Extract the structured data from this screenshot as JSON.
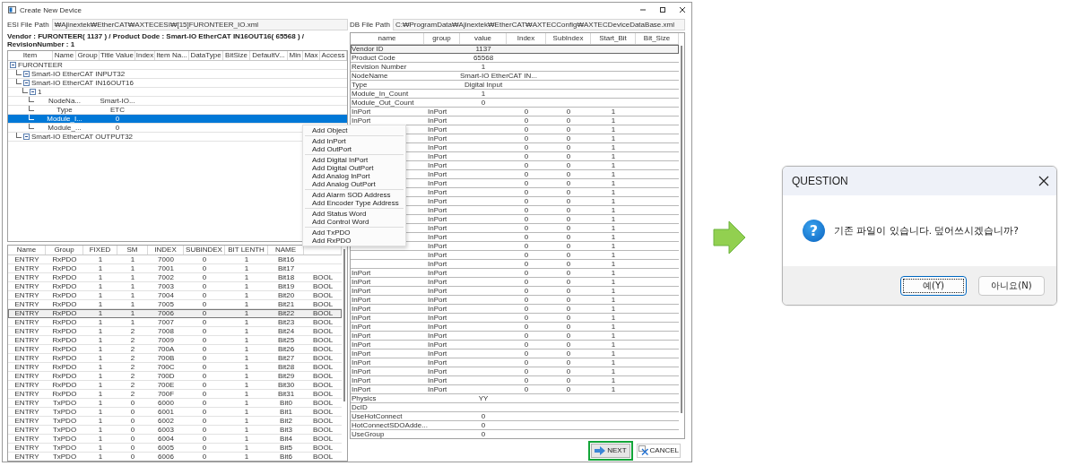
{
  "window": {
    "title": "Create New Device"
  },
  "esi_path": {
    "label": "ESI File Path",
    "value": "₩Ajinextek₩EtherCAT₩AXTECESI₩[15]FURONTEER_IO.xml"
  },
  "vendor_info": "Vendor : FURONTEER( 1137 ) / Product Dode : Smart-IO EtherCAT IN16OUT16( 65568 ) / RevisionNumber : 1",
  "tree_grid": {
    "columns": [
      "Item",
      "Name",
      "Group",
      "Title Value",
      "Index",
      "Item Na...",
      "DataType",
      "BitSize",
      "DefaultV...",
      "Min",
      "Max",
      "Access"
    ],
    "nodes": [
      {
        "item": "FURONTEER",
        "selected": false,
        "children": [
          {
            "item": "Smart-IO EtherCAT INPUT32",
            "selected": false
          },
          {
            "item": "Smart-IO EtherCAT IN16OUT16",
            "selected": false,
            "children": [
              {
                "item": "1",
                "selected": false,
                "children": [
                  {
                    "name": "NodeNa...",
                    "title_value": "Smart-IO...",
                    "selected": false
                  },
                  {
                    "name": "Type",
                    "title_value": "ETC",
                    "selected": false
                  },
                  {
                    "name": "Module_I...",
                    "title_value": "0",
                    "selected": true
                  },
                  {
                    "name": "Module_...",
                    "title_value": "0",
                    "selected": false
                  }
                ]
              }
            ]
          },
          {
            "item": "Smart-IO EtherCAT OUTPUT32",
            "selected": false
          }
        ]
      }
    ]
  },
  "pdo_table": {
    "columns": [
      "Name",
      "Group",
      "FIXED",
      "SM",
      "INDEX",
      "SUBINDEX",
      "BIT LENTH",
      "NAME"
    ],
    "rows": [
      {
        "cells": [
          "ENTRY",
          "RxPDO",
          "1",
          "1",
          "7000",
          "0",
          "1",
          "Bit16"
        ],
        "selected": false
      },
      {
        "cells": [
          "ENTRY",
          "RxPDO",
          "1",
          "1",
          "7001",
          "0",
          "1",
          "Bit17"
        ],
        "selected": false
      },
      {
        "cells": [
          "ENTRY",
          "RxPDO",
          "1",
          "1",
          "7002",
          "0",
          "1",
          "Bit18",
          "BOOL"
        ],
        "selected": false
      },
      {
        "cells": [
          "ENTRY",
          "RxPDO",
          "1",
          "1",
          "7003",
          "0",
          "1",
          "Bit19",
          "BOOL"
        ],
        "selected": false
      },
      {
        "cells": [
          "ENTRY",
          "RxPDO",
          "1",
          "1",
          "7004",
          "0",
          "1",
          "Bit20",
          "BOOL"
        ],
        "selected": false
      },
      {
        "cells": [
          "ENTRY",
          "RxPDO",
          "1",
          "1",
          "7005",
          "0",
          "1",
          "Bit21",
          "BOOL"
        ],
        "selected": false
      },
      {
        "cells": [
          "ENTRY",
          "RxPDO",
          "1",
          "1",
          "7006",
          "0",
          "1",
          "Bit22",
          "BOOL"
        ],
        "selected": true
      },
      {
        "cells": [
          "ENTRY",
          "RxPDO",
          "1",
          "1",
          "7007",
          "0",
          "1",
          "Bit23",
          "BOOL"
        ],
        "selected": false
      },
      {
        "cells": [
          "ENTRY",
          "RxPDO",
          "1",
          "2",
          "7008",
          "0",
          "1",
          "Bit24",
          "BOOL"
        ],
        "selected": false
      },
      {
        "cells": [
          "ENTRY",
          "RxPDO",
          "1",
          "2",
          "7009",
          "0",
          "1",
          "Bit25",
          "BOOL"
        ],
        "selected": false
      },
      {
        "cells": [
          "ENTRY",
          "RxPDO",
          "1",
          "2",
          "700A",
          "0",
          "1",
          "Bit26",
          "BOOL"
        ],
        "selected": false
      },
      {
        "cells": [
          "ENTRY",
          "RxPDO",
          "1",
          "2",
          "700B",
          "0",
          "1",
          "Bit27",
          "BOOL"
        ],
        "selected": false
      },
      {
        "cells": [
          "ENTRY",
          "RxPDO",
          "1",
          "2",
          "700C",
          "0",
          "1",
          "Bit28",
          "BOOL"
        ],
        "selected": false
      },
      {
        "cells": [
          "ENTRY",
          "RxPDO",
          "1",
          "2",
          "700D",
          "0",
          "1",
          "Bit29",
          "BOOL"
        ],
        "selected": false
      },
      {
        "cells": [
          "ENTRY",
          "RxPDO",
          "1",
          "2",
          "700E",
          "0",
          "1",
          "Bit30",
          "BOOL"
        ],
        "selected": false
      },
      {
        "cells": [
          "ENTRY",
          "RxPDO",
          "1",
          "2",
          "700F",
          "0",
          "1",
          "Bit31",
          "BOOL"
        ],
        "selected": false
      },
      {
        "cells": [
          "ENTRY",
          "TxPDO",
          "1",
          "0",
          "6000",
          "0",
          "1",
          "Bit0",
          "BOOL"
        ],
        "selected": false
      },
      {
        "cells": [
          "ENTRY",
          "TxPDO",
          "1",
          "0",
          "6001",
          "0",
          "1",
          "Bit1",
          "BOOL"
        ],
        "selected": false
      },
      {
        "cells": [
          "ENTRY",
          "TxPDO",
          "1",
          "0",
          "6002",
          "0",
          "1",
          "Bit2",
          "BOOL"
        ],
        "selected": false
      },
      {
        "cells": [
          "ENTRY",
          "TxPDO",
          "1",
          "0",
          "6003",
          "0",
          "1",
          "Bit3",
          "BOOL"
        ],
        "selected": false
      },
      {
        "cells": [
          "ENTRY",
          "TxPDO",
          "1",
          "0",
          "6004",
          "0",
          "1",
          "Bit4",
          "BOOL"
        ],
        "selected": false
      },
      {
        "cells": [
          "ENTRY",
          "TxPDO",
          "1",
          "0",
          "6005",
          "0",
          "1",
          "Bit5",
          "BOOL"
        ],
        "selected": false
      },
      {
        "cells": [
          "ENTRY",
          "TxPDO",
          "1",
          "0",
          "6006",
          "0",
          "1",
          "Bit6",
          "BOOL"
        ],
        "selected": false
      }
    ]
  },
  "db_path": {
    "label": "DB File Path",
    "value": "C:₩ProgramData₩Ajinextek₩EtherCAT₩AXTECConfig₩AXTECDeviceDataBase.xml"
  },
  "db_table": {
    "columns": [
      "name",
      "group",
      "value",
      "Index",
      "SubIndex",
      "Start_Bit",
      "Bit_Size"
    ],
    "rows": [
      {
        "name": "Vendor ID",
        "value": "1137",
        "selected": true
      },
      {
        "name": "Product Code",
        "value": "65568",
        "selected": false
      },
      {
        "name": "Revision Number",
        "value": "1",
        "selected": false
      },
      {
        "name": "NodeName",
        "value": "Smart-IO EtherCAT IN...",
        "selected": false
      },
      {
        "name": "Type",
        "value": "Digital Input",
        "selected": false
      },
      {
        "name": "Module_In_Count",
        "value": "1",
        "selected": false
      },
      {
        "name": "Module_Out_Count",
        "value": "0",
        "selected": false
      },
      {
        "name": "InPort",
        "group": "InPort",
        "index": "0",
        "subindex": "0",
        "start_bit": "1",
        "selected": false
      },
      {
        "name": "InPort",
        "group": "InPort",
        "index": "0",
        "subindex": "0",
        "start_bit": "1",
        "selected": false
      },
      {
        "group": "InPort",
        "index": "0",
        "subindex": "0",
        "start_bit": "1",
        "selected": false
      },
      {
        "group": "InPort",
        "index": "0",
        "subindex": "0",
        "start_bit": "1",
        "selected": false
      },
      {
        "group": "InPort",
        "index": "0",
        "subindex": "0",
        "start_bit": "1",
        "selected": false
      },
      {
        "group": "InPort",
        "index": "0",
        "subindex": "0",
        "start_bit": "1",
        "selected": false
      },
      {
        "group": "InPort",
        "index": "0",
        "subindex": "0",
        "start_bit": "1",
        "selected": false
      },
      {
        "group": "InPort",
        "index": "0",
        "subindex": "0",
        "start_bit": "1",
        "selected": false
      },
      {
        "group": "InPort",
        "index": "0",
        "subindex": "0",
        "start_bit": "1",
        "selected": false
      },
      {
        "group": "InPort",
        "index": "0",
        "subindex": "0",
        "start_bit": "1",
        "selected": false
      },
      {
        "group": "InPort",
        "index": "0",
        "subindex": "0",
        "start_bit": "1",
        "selected": false
      },
      {
        "group": "InPort",
        "index": "0",
        "subindex": "0",
        "start_bit": "1",
        "selected": false
      },
      {
        "group": "InPort",
        "index": "0",
        "subindex": "0",
        "start_bit": "1",
        "selected": false
      },
      {
        "group": "InPort",
        "index": "0",
        "subindex": "0",
        "start_bit": "1",
        "selected": false
      },
      {
        "group": "InPort",
        "index": "0",
        "subindex": "0",
        "start_bit": "1",
        "selected": false
      },
      {
        "group": "InPort",
        "index": "0",
        "subindex": "0",
        "start_bit": "1",
        "selected": false
      },
      {
        "group": "InPort",
        "index": "0",
        "subindex": "0",
        "start_bit": "1",
        "selected": false
      },
      {
        "group": "InPort",
        "index": "0",
        "subindex": "0",
        "start_bit": "1",
        "selected": false
      },
      {
        "name": "InPort",
        "group": "InPort",
        "index": "0",
        "subindex": "0",
        "start_bit": "1",
        "selected": false
      },
      {
        "name": "InPort",
        "group": "InPort",
        "index": "0",
        "subindex": "0",
        "start_bit": "1",
        "selected": false
      },
      {
        "name": "InPort",
        "group": "InPort",
        "index": "0",
        "subindex": "0",
        "start_bit": "1",
        "selected": false
      },
      {
        "name": "InPort",
        "group": "InPort",
        "index": "0",
        "subindex": "0",
        "start_bit": "1",
        "selected": false
      },
      {
        "name": "InPort",
        "group": "InPort",
        "index": "0",
        "subindex": "0",
        "start_bit": "1",
        "selected": false
      },
      {
        "name": "InPort",
        "group": "InPort",
        "index": "0",
        "subindex": "0",
        "start_bit": "1",
        "selected": false
      },
      {
        "name": "InPort",
        "group": "InPort",
        "index": "0",
        "subindex": "0",
        "start_bit": "1",
        "selected": false
      },
      {
        "name": "InPort",
        "group": "InPort",
        "index": "0",
        "subindex": "0",
        "start_bit": "1",
        "selected": false
      },
      {
        "name": "InPort",
        "group": "InPort",
        "index": "0",
        "subindex": "0",
        "start_bit": "1",
        "selected": false
      },
      {
        "name": "InPort",
        "group": "InPort",
        "index": "0",
        "subindex": "0",
        "start_bit": "1",
        "selected": false
      },
      {
        "name": "InPort",
        "group": "InPort",
        "index": "0",
        "subindex": "0",
        "start_bit": "1",
        "selected": false
      },
      {
        "name": "InPort",
        "group": "InPort",
        "index": "0",
        "subindex": "0",
        "start_bit": "1",
        "selected": false
      },
      {
        "name": "InPort",
        "group": "InPort",
        "index": "0",
        "subindex": "0",
        "start_bit": "1",
        "selected": false
      },
      {
        "name": "InPort",
        "group": "InPort",
        "index": "0",
        "subindex": "0",
        "start_bit": "1",
        "selected": false
      },
      {
        "name": "Physics",
        "value": "YY",
        "selected": false
      },
      {
        "name": "DcID",
        "selected": false
      },
      {
        "name": "UseHotConnect",
        "value": "0",
        "selected": false
      },
      {
        "name": "HotConnectSDOAdde...",
        "value": "0",
        "selected": false
      },
      {
        "name": "UseGroup",
        "value": "0",
        "selected": false
      }
    ]
  },
  "footer_buttons": [
    {
      "label": "NEXT",
      "kind": "next",
      "highlighted": true
    },
    {
      "label": "CANCEL",
      "kind": "cancel",
      "highlighted": false
    }
  ],
  "context_menu": {
    "groups": [
      [
        "Add Object"
      ],
      [
        "Add InPort",
        "Add OutPort"
      ],
      [
        "Add Digital InPort",
        "Add Digital OutPort",
        "Add Analog InPort",
        "Add Analog OutPort"
      ],
      [
        "Add Alarm SOD Address",
        "Add Encoder Type Address"
      ],
      [
        "Add Status Word",
        "Add Control Word"
      ],
      [
        "Add TxPDO",
        "Add RxPDO"
      ]
    ]
  },
  "dialog": {
    "title": "QUESTION",
    "icon": "?",
    "message": "기존 파일이 있습니다. 덮어쓰시겠습니까?",
    "buttons": [
      {
        "label": "예(Y)",
        "focused": true
      },
      {
        "label": "아니요(N)",
        "focused": false
      }
    ]
  }
}
